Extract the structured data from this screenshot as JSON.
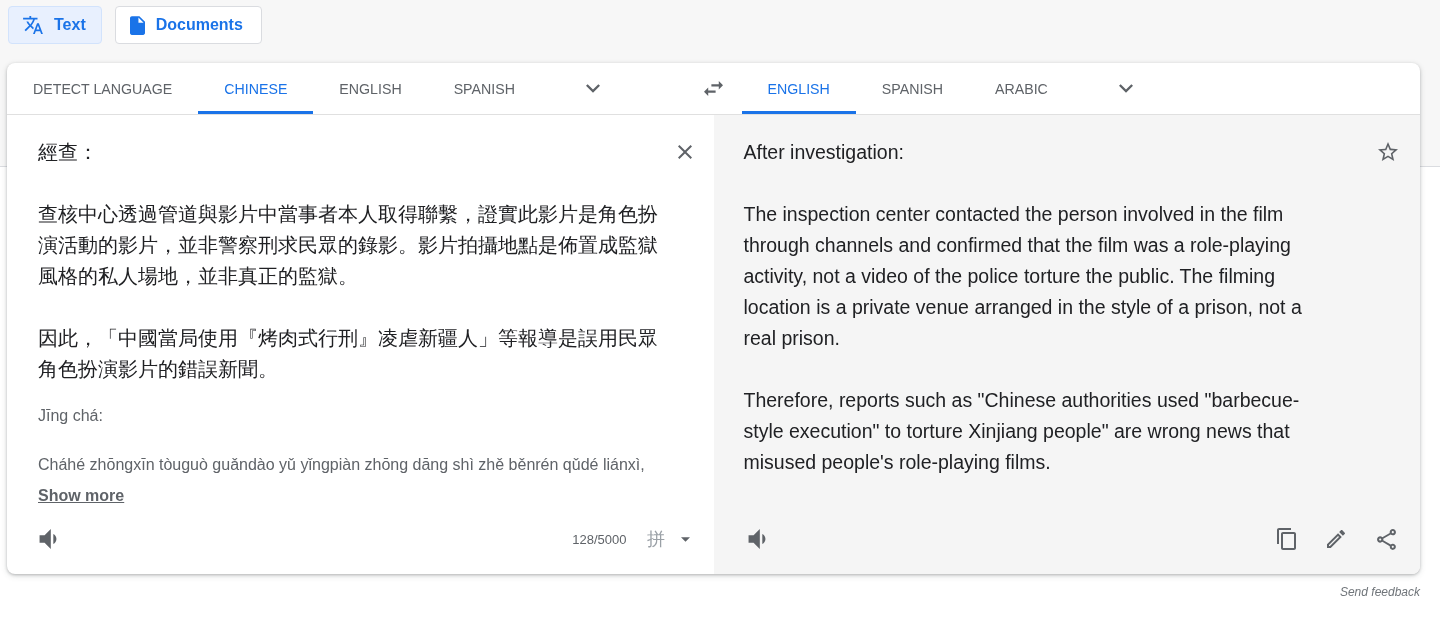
{
  "modes": [
    {
      "label": "Text",
      "selected": true
    },
    {
      "label": "Documents",
      "selected": false
    }
  ],
  "source_tabs": [
    {
      "label": "DETECT LANGUAGE",
      "selected": false
    },
    {
      "label": "CHINESE",
      "selected": true
    },
    {
      "label": "ENGLISH",
      "selected": false
    },
    {
      "label": "SPANISH",
      "selected": false
    }
  ],
  "target_tabs": [
    {
      "label": "ENGLISH",
      "selected": true
    },
    {
      "label": "SPANISH",
      "selected": false
    },
    {
      "label": "ARABIC",
      "selected": false
    }
  ],
  "source": {
    "paragraphs": [
      "經查：",
      "查核中心透過管道與影片中當事者本人取得聯繫，證實此影片是角色扮演活動的影片，並非警察刑求民眾的錄影。影片拍攝地點是佈置成監獄風格的私人場地，並非真正的監獄。",
      "因此，「中國當局使用『烤肉式行刑』凌虐新疆人」等報導是誤用民眾角色扮演影片的錯誤新聞。"
    ],
    "romanization": [
      "Jīng chá:",
      "Cháhé zhōngxīn tòuguò guǎndào yǔ yǐngpiàn zhōng dāng shì zhě běnrén qǔdé liánxì,"
    ],
    "show_more": "Show more",
    "char_count": "128/5000",
    "input_tool": "拼"
  },
  "translation": {
    "paragraphs": [
      "After investigation:",
      "The inspection center contacted the person involved in the film through channels and confirmed that the film was a role-playing activity, not a video of the police torture the public. The filming location is a private venue arranged in the style of a prison, not a real prison.",
      "Therefore, reports such as \"Chinese authorities used \"barbecue-style execution\" to torture Xinjiang people\" are wrong news that misused people's role-playing films."
    ],
    "starred": false
  },
  "feedback": "Send feedback"
}
